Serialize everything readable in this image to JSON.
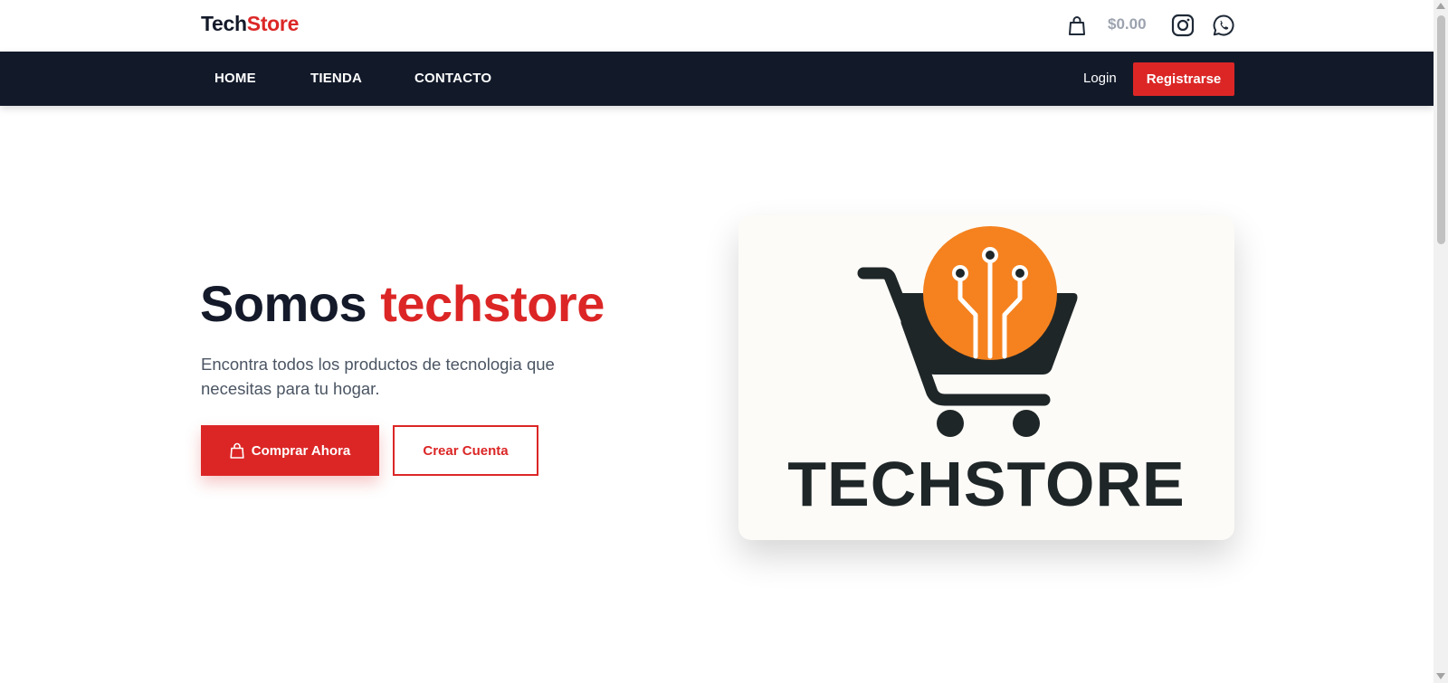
{
  "header": {
    "brand_part1": "Tech",
    "brand_part2": "Store",
    "cart_total": "$0.00",
    "icons": [
      "shopping-bag-icon",
      "instagram-icon",
      "whatsapp-icon"
    ]
  },
  "nav": {
    "links": [
      "HOME",
      "TIENDA",
      "CONTACTO"
    ],
    "login_label": "Login",
    "register_label": "Registrarse"
  },
  "hero": {
    "title_part1": "Somos",
    "title_part2": "techstore",
    "description": "Encontra todos los productos de tecnologia que necesitas para tu hogar.",
    "primary_button": "Comprar Ahora",
    "secondary_button": "Crear Cuenta",
    "logo_word": "TECHSTORE"
  },
  "colors": {
    "accent": "#dc2626",
    "dark": "#121a2a",
    "muted": "#9ca3af",
    "logo_orange": "#f5821f"
  }
}
